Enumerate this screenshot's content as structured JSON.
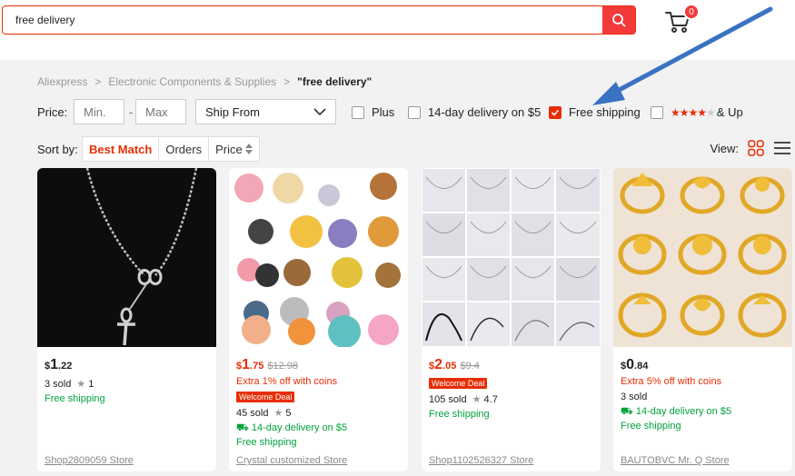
{
  "search": {
    "query": "free delivery"
  },
  "cart": {
    "count": "0"
  },
  "breadcrumb": {
    "items": [
      "Aliexpress",
      "Electronic Components & Supplies"
    ],
    "current": "\"free delivery\"",
    "separator": ">"
  },
  "filters": {
    "price_label": "Price:",
    "min_placeholder": "Min.",
    "max_placeholder": "Max",
    "dash": "-",
    "ship_from": "Ship From",
    "plus": "Plus",
    "delivery_14": "14-day delivery on $5",
    "free_shipping": "Free shipping",
    "free_shipping_checked": true,
    "stars_up": "& Up"
  },
  "sort": {
    "label": "Sort by:",
    "best_match": "Best Match",
    "orders": "Orders",
    "price": "Price",
    "view_label": "View:"
  },
  "colors": {
    "accent": "#e62e04",
    "green": "#00a33c",
    "arrow": "#3a72c4"
  },
  "products": [
    {
      "cur": "$",
      "big": "1",
      "small": ".22",
      "old": "",
      "price_red": false,
      "sold": "3 sold",
      "rating": "1",
      "shipping": "Free shipping",
      "store": "Shop2809059 Store"
    },
    {
      "cur": "$",
      "big": "1",
      "small": ".75",
      "old": "$12.98",
      "price_red": true,
      "promo": "Extra 1% off with coins",
      "badge": "Welcome Deal",
      "sold": "45 sold",
      "rating": "5",
      "delivery": "14-day delivery on $5",
      "shipping": "Free shipping",
      "store": "Crystal customized Store"
    },
    {
      "cur": "$",
      "big": "2",
      "small": ".05",
      "old": "$9.4",
      "price_red": true,
      "badge": "Welcome Deal",
      "sold": "105 sold",
      "rating": "4.7",
      "shipping": "Free shipping",
      "store": "Shop1102526327 Store"
    },
    {
      "cur": "$",
      "big": "0",
      "small": ".84",
      "old": "",
      "price_red": false,
      "promo": "Extra 5% off with coins",
      "sold": "3 sold",
      "delivery": "14-day delivery on $5",
      "shipping": "Free shipping",
      "store": "BAUTOBVC Mr. Q Store"
    }
  ]
}
